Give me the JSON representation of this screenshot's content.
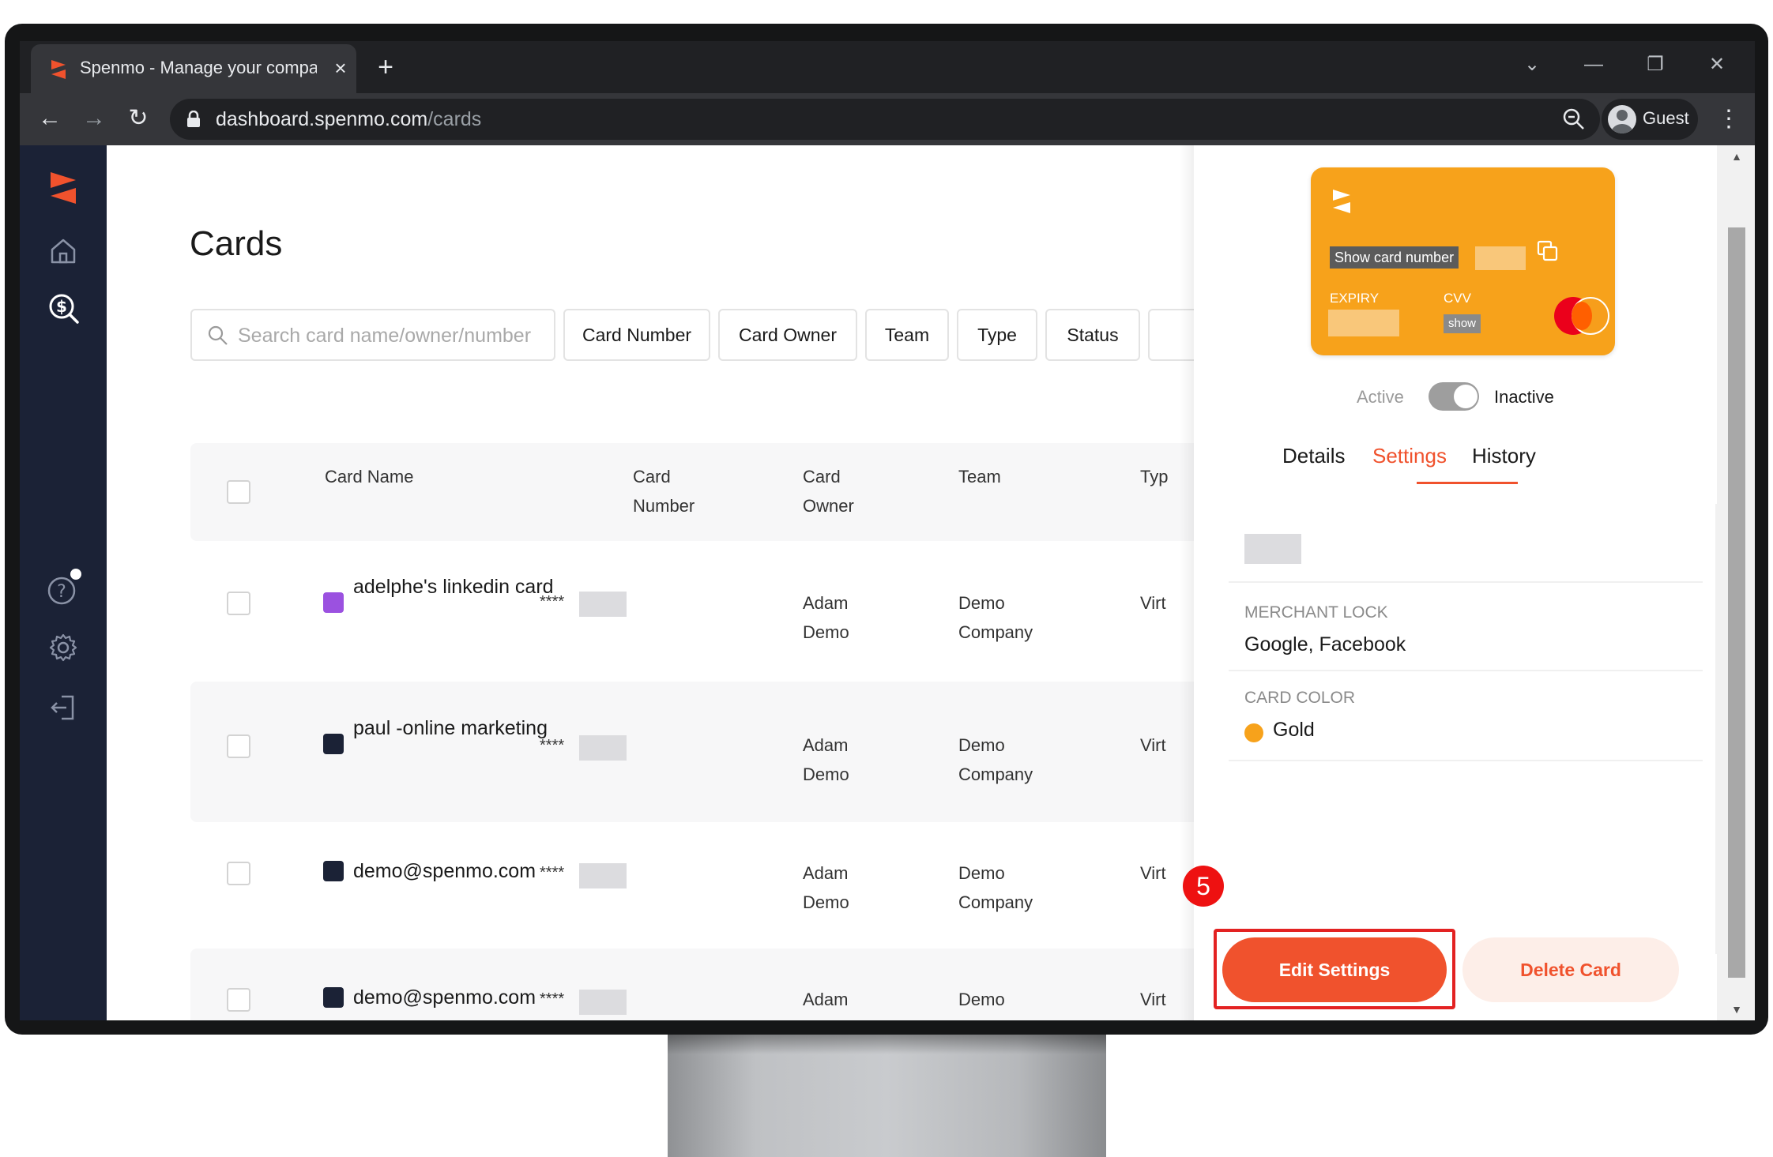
{
  "browser": {
    "tab_title": "Spenmo - Manage your company",
    "tab_close": "×",
    "new_tab": "+",
    "url_host": "dashboard.spenmo.com",
    "url_path": "/cards",
    "profile_label": "Guest",
    "menu_glyph": "⋮",
    "back_glyph": "←",
    "forward_glyph": "→",
    "reload_glyph": "↻",
    "dropdown_glyph": "⌄",
    "minimize_glyph": "—",
    "restore_glyph": "❐",
    "close_glyph": "✕"
  },
  "sidebar": {
    "items": [
      {
        "name": "logo",
        "icon": "spenmo-logo"
      },
      {
        "name": "home",
        "icon": "home-icon"
      },
      {
        "name": "cards",
        "icon": "dollar-search-icon"
      },
      {
        "name": "help",
        "icon": "help-icon"
      },
      {
        "name": "settings",
        "icon": "gear-icon"
      },
      {
        "name": "logout",
        "icon": "logout-icon"
      }
    ]
  },
  "page": {
    "title": "Cards",
    "search_placeholder": "Search card name/owner/number",
    "filters": [
      "Card Number",
      "Card Owner",
      "Team",
      "Type",
      "Status"
    ]
  },
  "table": {
    "headers": {
      "card_name": "Card Name",
      "card_number": [
        "Card",
        "Number"
      ],
      "card_owner": [
        "Card",
        "Owner"
      ],
      "team": "Team",
      "type": "Typ"
    },
    "rows": [
      {
        "name": "adelphe's linkedin card",
        "swatch": "#9b51e0",
        "number_prefix": "****",
        "owner": [
          "Adam",
          "Demo"
        ],
        "team": [
          "Demo",
          "Company"
        ],
        "type": "Virt"
      },
      {
        "name": "paul -online marketing",
        "swatch": "#1b2236",
        "number_prefix": "****",
        "owner": [
          "Adam",
          "Demo"
        ],
        "team": [
          "Demo",
          "Company"
        ],
        "type": "Virt"
      },
      {
        "name": "demo@spenmo.com",
        "swatch": "#1b2236",
        "number_prefix": "****",
        "owner": [
          "Adam",
          "Demo"
        ],
        "team": [
          "Demo",
          "Company"
        ],
        "type": "Virt"
      },
      {
        "name": "demo@spenmo.com",
        "swatch": "#1b2236",
        "number_prefix": "****",
        "owner": [
          "Adam",
          ""
        ],
        "team": [
          "Demo",
          ""
        ],
        "type": "Virt"
      }
    ]
  },
  "panel": {
    "card": {
      "show_number_label": "Show card number",
      "expiry_label": "EXPIRY",
      "cvv_label": "CVV",
      "cvv_show": "show",
      "color": "#f7a21b"
    },
    "toggle": {
      "active_label": "Active",
      "inactive_label": "Inactive",
      "state": "inactive"
    },
    "tabs": [
      "Details",
      "Settings",
      "History"
    ],
    "active_tab": "Settings",
    "merchant_lock": {
      "label": "MERCHANT LOCK",
      "value": "Google, Facebook"
    },
    "card_color": {
      "label": "CARD COLOR",
      "value": "Gold",
      "swatch": "#f7a21b"
    },
    "edit_button": "Edit Settings",
    "delete_button": "Delete Card",
    "step_badge": "5"
  },
  "colors": {
    "accent": "#f0522d",
    "sidebar": "#1b2236",
    "highlight": "#e32222"
  }
}
